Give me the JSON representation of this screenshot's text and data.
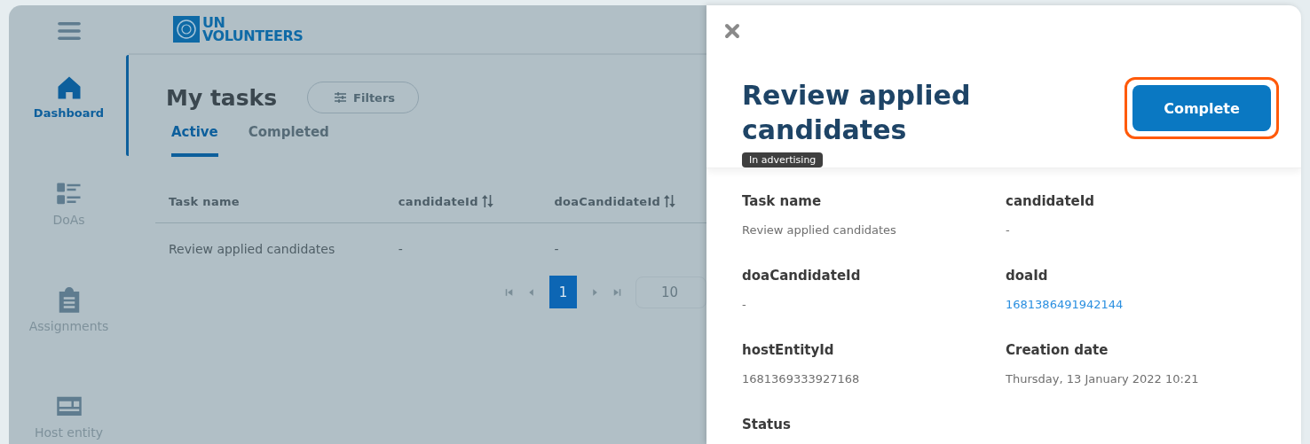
{
  "sidebar": {
    "items": [
      {
        "label": "Dashboard",
        "kind": "home",
        "selected": true
      },
      {
        "label": "DoAs",
        "kind": "list",
        "selected": false
      },
      {
        "label": "Assignments",
        "kind": "clipboard",
        "selected": false
      },
      {
        "label": "Host entity",
        "kind": "card",
        "selected": false
      }
    ]
  },
  "logo": {
    "line1": "UN",
    "line2": "VOLUNTEERS"
  },
  "page": {
    "title": "My tasks",
    "filter_button": "Filters",
    "tabs": [
      {
        "label": "Active",
        "selected": true
      },
      {
        "label": "Completed",
        "selected": false
      }
    ],
    "table": {
      "columns": [
        {
          "label": "Task name",
          "sortable": false
        },
        {
          "label": "candidateId",
          "sortable": true
        },
        {
          "label": "doaCandidateId",
          "sortable": true
        }
      ],
      "rows": [
        [
          "Review applied candidates",
          "-",
          "-"
        ]
      ]
    },
    "pagination": {
      "pages": [
        {
          "label": "1",
          "selected": true
        }
      ],
      "page_size": "10"
    }
  },
  "drawer": {
    "title": "Review applied candidates",
    "badge": "In advertising",
    "action": "Complete",
    "action_highlighted": true,
    "fields": [
      {
        "label": "Task name",
        "value": "Review applied candidates",
        "kind": "text"
      },
      {
        "label": "candidateId",
        "value": "-",
        "kind": "text"
      },
      {
        "label": "doaCandidateId",
        "value": "-",
        "kind": "text"
      },
      {
        "label": "doaId",
        "value": "1681386491942144",
        "kind": "link"
      },
      {
        "label": "hostEntityId",
        "value": "1681369333927168",
        "kind": "text"
      },
      {
        "label": "Creation date",
        "value": "Thursday, 13 January 2022 10:21",
        "kind": "text"
      },
      {
        "label": "Status",
        "kind": "label-only"
      }
    ]
  }
}
